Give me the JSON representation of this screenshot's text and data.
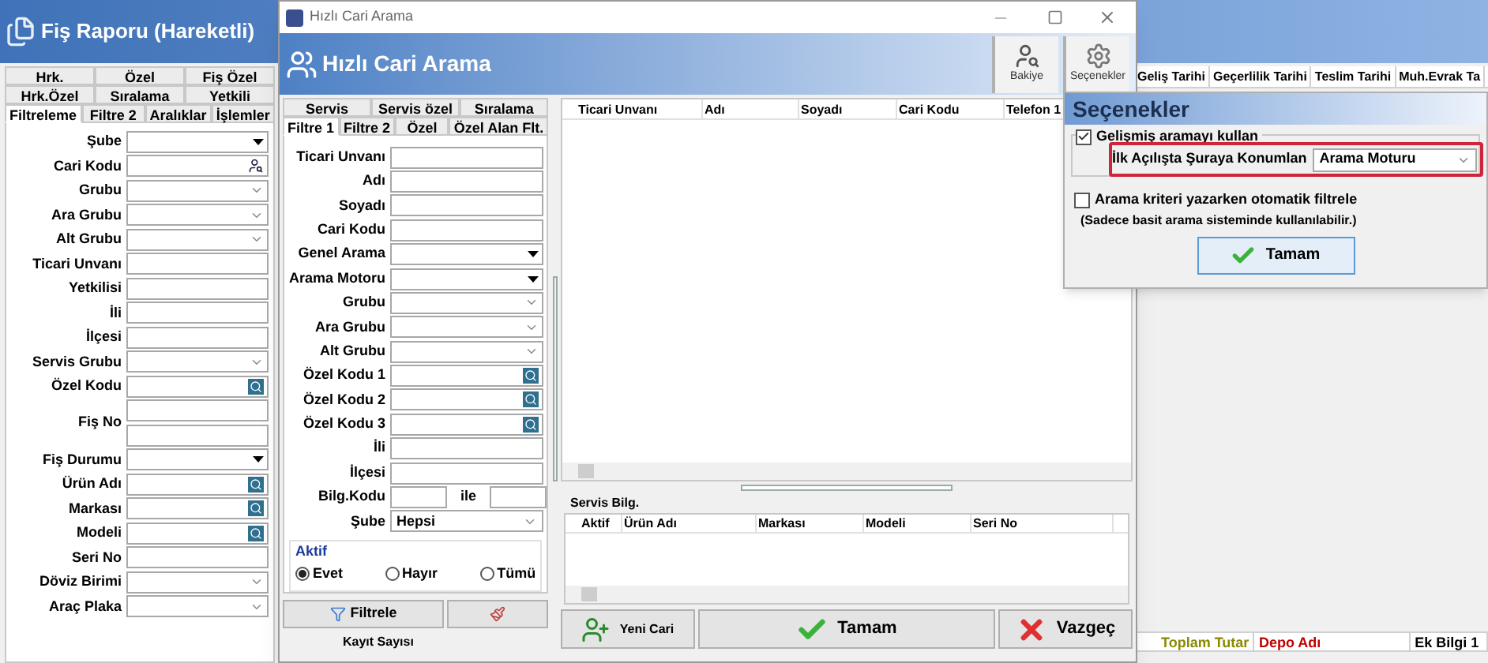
{
  "report_window": {
    "title": "Fiş Raporu (Hareketli)",
    "tab_rows": [
      [
        {
          "label": "Hrk.",
          "selected": false
        },
        {
          "label": "Özel",
          "selected": false
        },
        {
          "label": "Fiş Özel",
          "selected": false
        }
      ],
      [
        {
          "label": "Hrk.Özel",
          "selected": false
        },
        {
          "label": "Sıralama",
          "selected": false
        },
        {
          "label": "Yetkili",
          "selected": false
        }
      ],
      [
        {
          "label": "Filtreleme",
          "selected": true
        },
        {
          "label": "Filtre 2",
          "selected": false
        },
        {
          "label": "Aralıklar",
          "selected": false
        },
        {
          "label": "İşlemler",
          "selected": false
        }
      ]
    ],
    "fields": [
      {
        "label": "Şube",
        "kind": "combo"
      },
      {
        "label": "Cari Kodu",
        "kind": "person"
      },
      {
        "label": "Grubu",
        "kind": "select"
      },
      {
        "label": "Ara Grubu",
        "kind": "select"
      },
      {
        "label": "Alt Grubu",
        "kind": "select"
      },
      {
        "label": "Ticari Unvanı",
        "kind": "text"
      },
      {
        "label": "Yetkilisi",
        "kind": "text"
      },
      {
        "label": "İli",
        "kind": "text"
      },
      {
        "label": "İlçesi",
        "kind": "text"
      },
      {
        "label": "Servis Grubu",
        "kind": "select"
      },
      {
        "label": "Özel Kodu",
        "kind": "lookup"
      },
      {
        "label": "Fiş No",
        "kind": "double"
      },
      {
        "label": "Fiş Durumu",
        "kind": "combo"
      },
      {
        "label": "Ürün Adı",
        "kind": "lookup"
      },
      {
        "label": "Markası",
        "kind": "lookup"
      },
      {
        "label": "Modeli",
        "kind": "lookup"
      },
      {
        "label": "Seri No",
        "kind": "text"
      },
      {
        "label": "Döviz Birimi",
        "kind": "select"
      },
      {
        "label": "Araç Plaka",
        "kind": "select"
      }
    ],
    "columns_top": [
      "Geliş Tarihi",
      "Geçerlilik Tarihi",
      "Teslim Tarihi",
      "Muh.Evrak Ta"
    ],
    "columns_bottom": [
      {
        "label": "Toplam Tutar",
        "color": "#8a8a00"
      },
      {
        "label": "Depo Adı",
        "color": "#c00000"
      },
      {
        "label": "Ek Bilgi 1",
        "color": "#000000"
      }
    ]
  },
  "search_window": {
    "window_title": "Hızlı Cari Arama",
    "header": "Hızlı Cari Arama",
    "toolbar": [
      {
        "label": "Bakiye",
        "kind": "balance"
      },
      {
        "label": "Seçenekler",
        "kind": "options"
      }
    ],
    "tab_rows": [
      [
        {
          "label": "Servis",
          "selected": false
        },
        {
          "label": "Servis özel",
          "selected": false
        },
        {
          "label": "Sıralama",
          "selected": false
        }
      ],
      [
        {
          "label": "Filtre 1",
          "selected": true
        },
        {
          "label": "Filtre 2",
          "selected": false
        },
        {
          "label": "Özel",
          "selected": false
        },
        {
          "label": "Özel Alan Flt.",
          "selected": false
        }
      ]
    ],
    "fields": [
      {
        "label": "Ticari Unvanı",
        "kind": "text"
      },
      {
        "label": "Adı",
        "kind": "text"
      },
      {
        "label": "Soyadı",
        "kind": "text"
      },
      {
        "label": "Cari Kodu",
        "kind": "text"
      },
      {
        "label": "Genel Arama",
        "kind": "combo"
      },
      {
        "label": "Arama Motoru",
        "kind": "combo"
      },
      {
        "label": "Grubu",
        "kind": "select"
      },
      {
        "label": "Ara Grubu",
        "kind": "select"
      },
      {
        "label": "Alt Grubu",
        "kind": "select"
      },
      {
        "label": "Özel Kodu 1",
        "kind": "lookup"
      },
      {
        "label": "Özel Kodu 2",
        "kind": "lookup"
      },
      {
        "label": "Özel Kodu 3",
        "kind": "lookup"
      },
      {
        "label": "İli",
        "kind": "text"
      },
      {
        "label": "İlçesi",
        "kind": "text"
      }
    ],
    "code_range": {
      "label": "Bilg.Kodu",
      "between": "ile"
    },
    "branch": {
      "label": "Şube",
      "value": "Hepsi"
    },
    "active": {
      "legend": "Aktif",
      "options": [
        {
          "label": "Evet",
          "selected": true
        },
        {
          "label": "Hayır",
          "selected": false
        },
        {
          "label": "Tümü",
          "selected": false
        }
      ]
    },
    "filter_button": "Filtrele",
    "record_count_label": "Kayıt Sayısı",
    "grid_columns": [
      "Ticari Unvanı",
      "Adı",
      "Soyadı",
      "Cari Kodu",
      "Telefon 1"
    ],
    "service": {
      "title": "Servis Bilg.",
      "columns": [
        "Aktif",
        "Ürün Adı",
        "Markası",
        "Modeli",
        "Seri No"
      ]
    },
    "buttons": [
      {
        "label": "Yeni Cari",
        "kind": "new"
      },
      {
        "label": "Tamam",
        "kind": "ok"
      },
      {
        "label": "Vazgeç",
        "kind": "cancel"
      }
    ]
  },
  "options_dialog": {
    "title": "Seçenekler",
    "advanced": {
      "label": "Gelişmiş aramayı kullan",
      "checked": true
    },
    "first_focus": {
      "label": "İlk Açılışta Şuraya Konumlan",
      "value": "Arama Moturu"
    },
    "auto_filter": {
      "label": "Arama kriteri yazarken otomatik filtrele",
      "checked": false
    },
    "note": "(Sadece basit arama sisteminde kullanılabilir.)",
    "ok_button": "Tamam"
  }
}
